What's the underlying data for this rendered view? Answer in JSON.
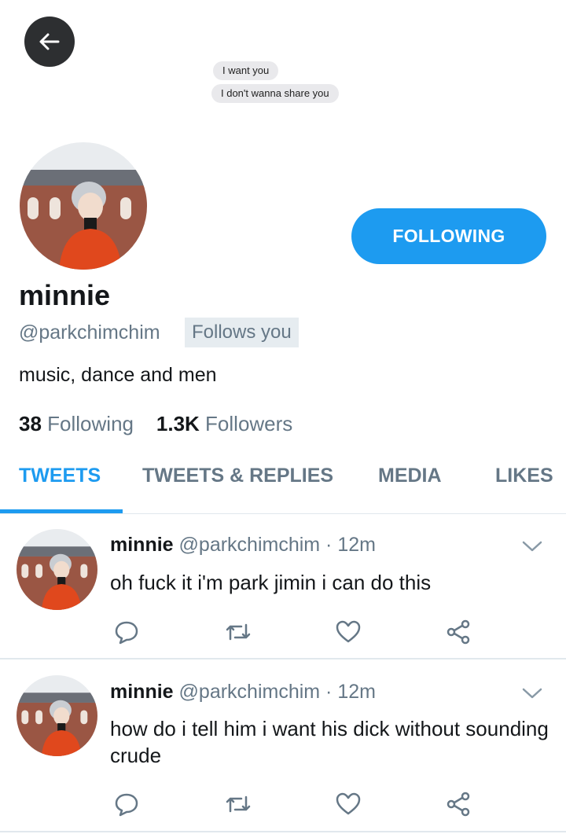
{
  "chat": {
    "messages": [
      "I want you",
      "I don't wanna share you"
    ]
  },
  "profile": {
    "name": "minnie",
    "handle": "@parkchimchim",
    "follows_you": "Follows you",
    "bio": "music, dance and men",
    "following_count": "38",
    "following_label": "Following",
    "followers_count": "1.3K",
    "followers_label": "Followers",
    "follow_button": "FOLLOWING"
  },
  "tabs": [
    {
      "label": "TWEETS",
      "active": true
    },
    {
      "label": "TWEETS & REPLIES",
      "active": false
    },
    {
      "label": "MEDIA",
      "active": false
    },
    {
      "label": "LIKES",
      "active": false
    }
  ],
  "tweets": [
    {
      "name": "minnie",
      "meta": "@parkchimchim · 12m",
      "text": "oh fuck it i'm park jimin i can do this"
    },
    {
      "name": "minnie",
      "meta": "@parkchimchim · 12m",
      "text": "how do i tell him i want his dick without sounding crude"
    }
  ],
  "colors": {
    "accent": "#1d9bf0",
    "secondary_text": "#657786",
    "back_button": "#2d2f31"
  },
  "icons": [
    "back-arrow-icon",
    "chevron-down-icon",
    "reply-icon",
    "retweet-icon",
    "like-icon",
    "share-icon"
  ]
}
